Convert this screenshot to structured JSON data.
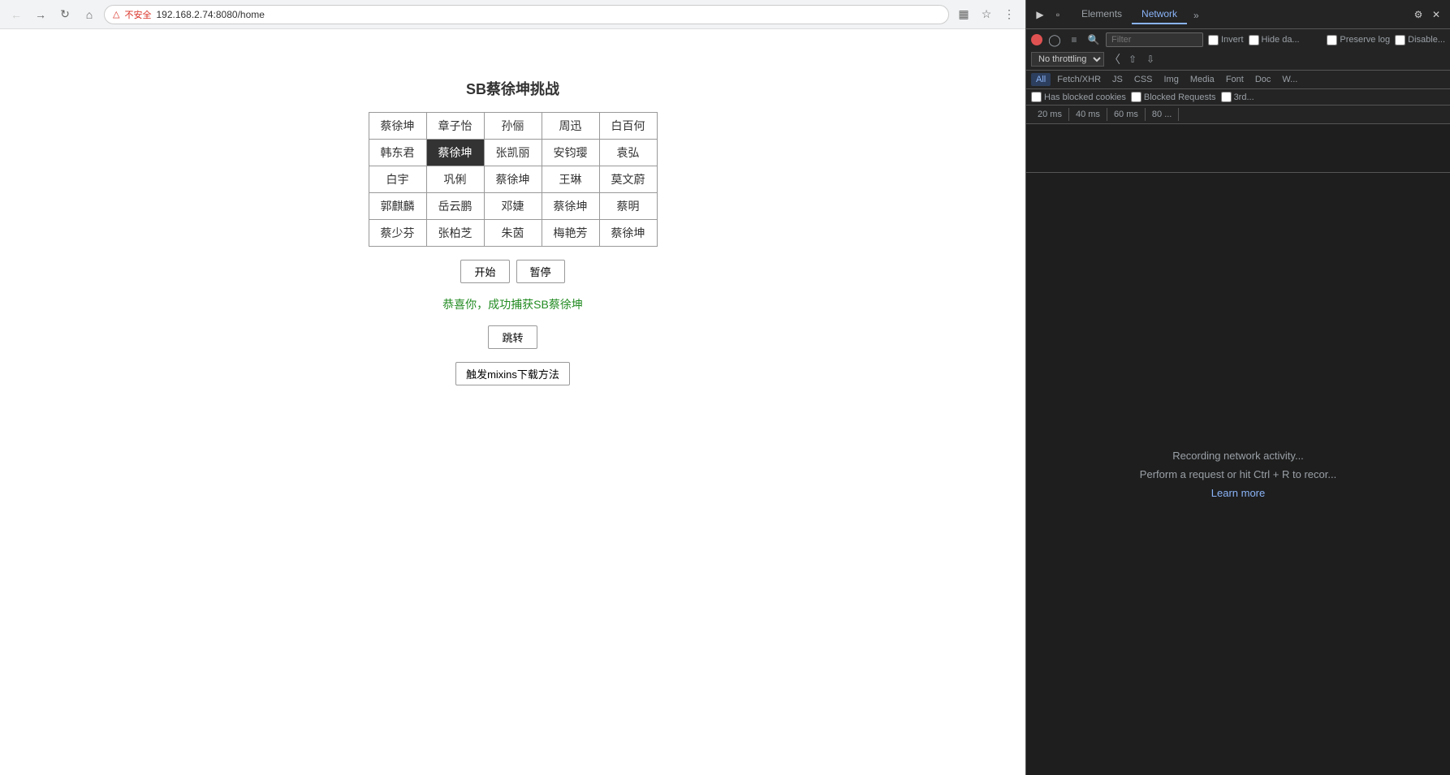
{
  "browser": {
    "url": "192.168.2.74:8080/home",
    "warning_text": "不安全",
    "back_disabled": true,
    "forward_disabled": true
  },
  "page": {
    "title": "SB蔡徐坤挑战",
    "table": {
      "rows": [
        [
          "蔡徐坤",
          "章子怡",
          "孙俪",
          "周迅",
          "白百何"
        ],
        [
          "韩东君",
          "蔡徐坤",
          "张凯丽",
          "安钧璎",
          "袁弘"
        ],
        [
          "白宇",
          "巩俐",
          "蔡徐坤",
          "王琳",
          "莫文蔚"
        ],
        [
          "郭麒麟",
          "岳云鹏",
          "邓婕",
          "蔡徐坤",
          "蔡明"
        ],
        [
          "蔡少芬",
          "张柏芝",
          "朱茵",
          "梅艳芳",
          "蔡徐坤"
        ]
      ],
      "highlighted_cell": {
        "row": 1,
        "col": 1
      }
    },
    "buttons": {
      "start": "开始",
      "pause": "暂停"
    },
    "success_message": "恭喜你，成功捕获SB蔡徐坤",
    "jump_btn": "跳转",
    "trigger_btn": "触发mixins下载方法"
  },
  "devtools": {
    "tabs": [
      {
        "label": "Elements",
        "active": false
      },
      {
        "label": "Network",
        "active": true
      }
    ],
    "toolbar_icons": [
      "inspect",
      "device",
      "more"
    ],
    "filter_placeholder": "Filter",
    "filter_options": {
      "invert": "Invert",
      "hide_data": "Hide da..."
    },
    "filter_row1_checkboxes": [
      {
        "label": "Preserve log"
      },
      {
        "label": "Disable..."
      }
    ],
    "throttle": "No throttling",
    "type_filters": [
      "All",
      "Fetch/XHR",
      "JS",
      "CSS",
      "Img",
      "Media",
      "Font",
      "Doc",
      "W..."
    ],
    "row2_checkboxes": [
      {
        "label": "Has blocked cookies"
      },
      {
        "label": "Blocked Requests"
      },
      {
        "label": "3rd..."
      }
    ],
    "timeline_labels": [
      "20 ms",
      "40 ms",
      "60 ms",
      "80 ..."
    ],
    "recording_text": "Recording network activity...",
    "perform_text": "Perform a request or hit Ctrl + R to recor...",
    "learn_more": "Learn more"
  }
}
